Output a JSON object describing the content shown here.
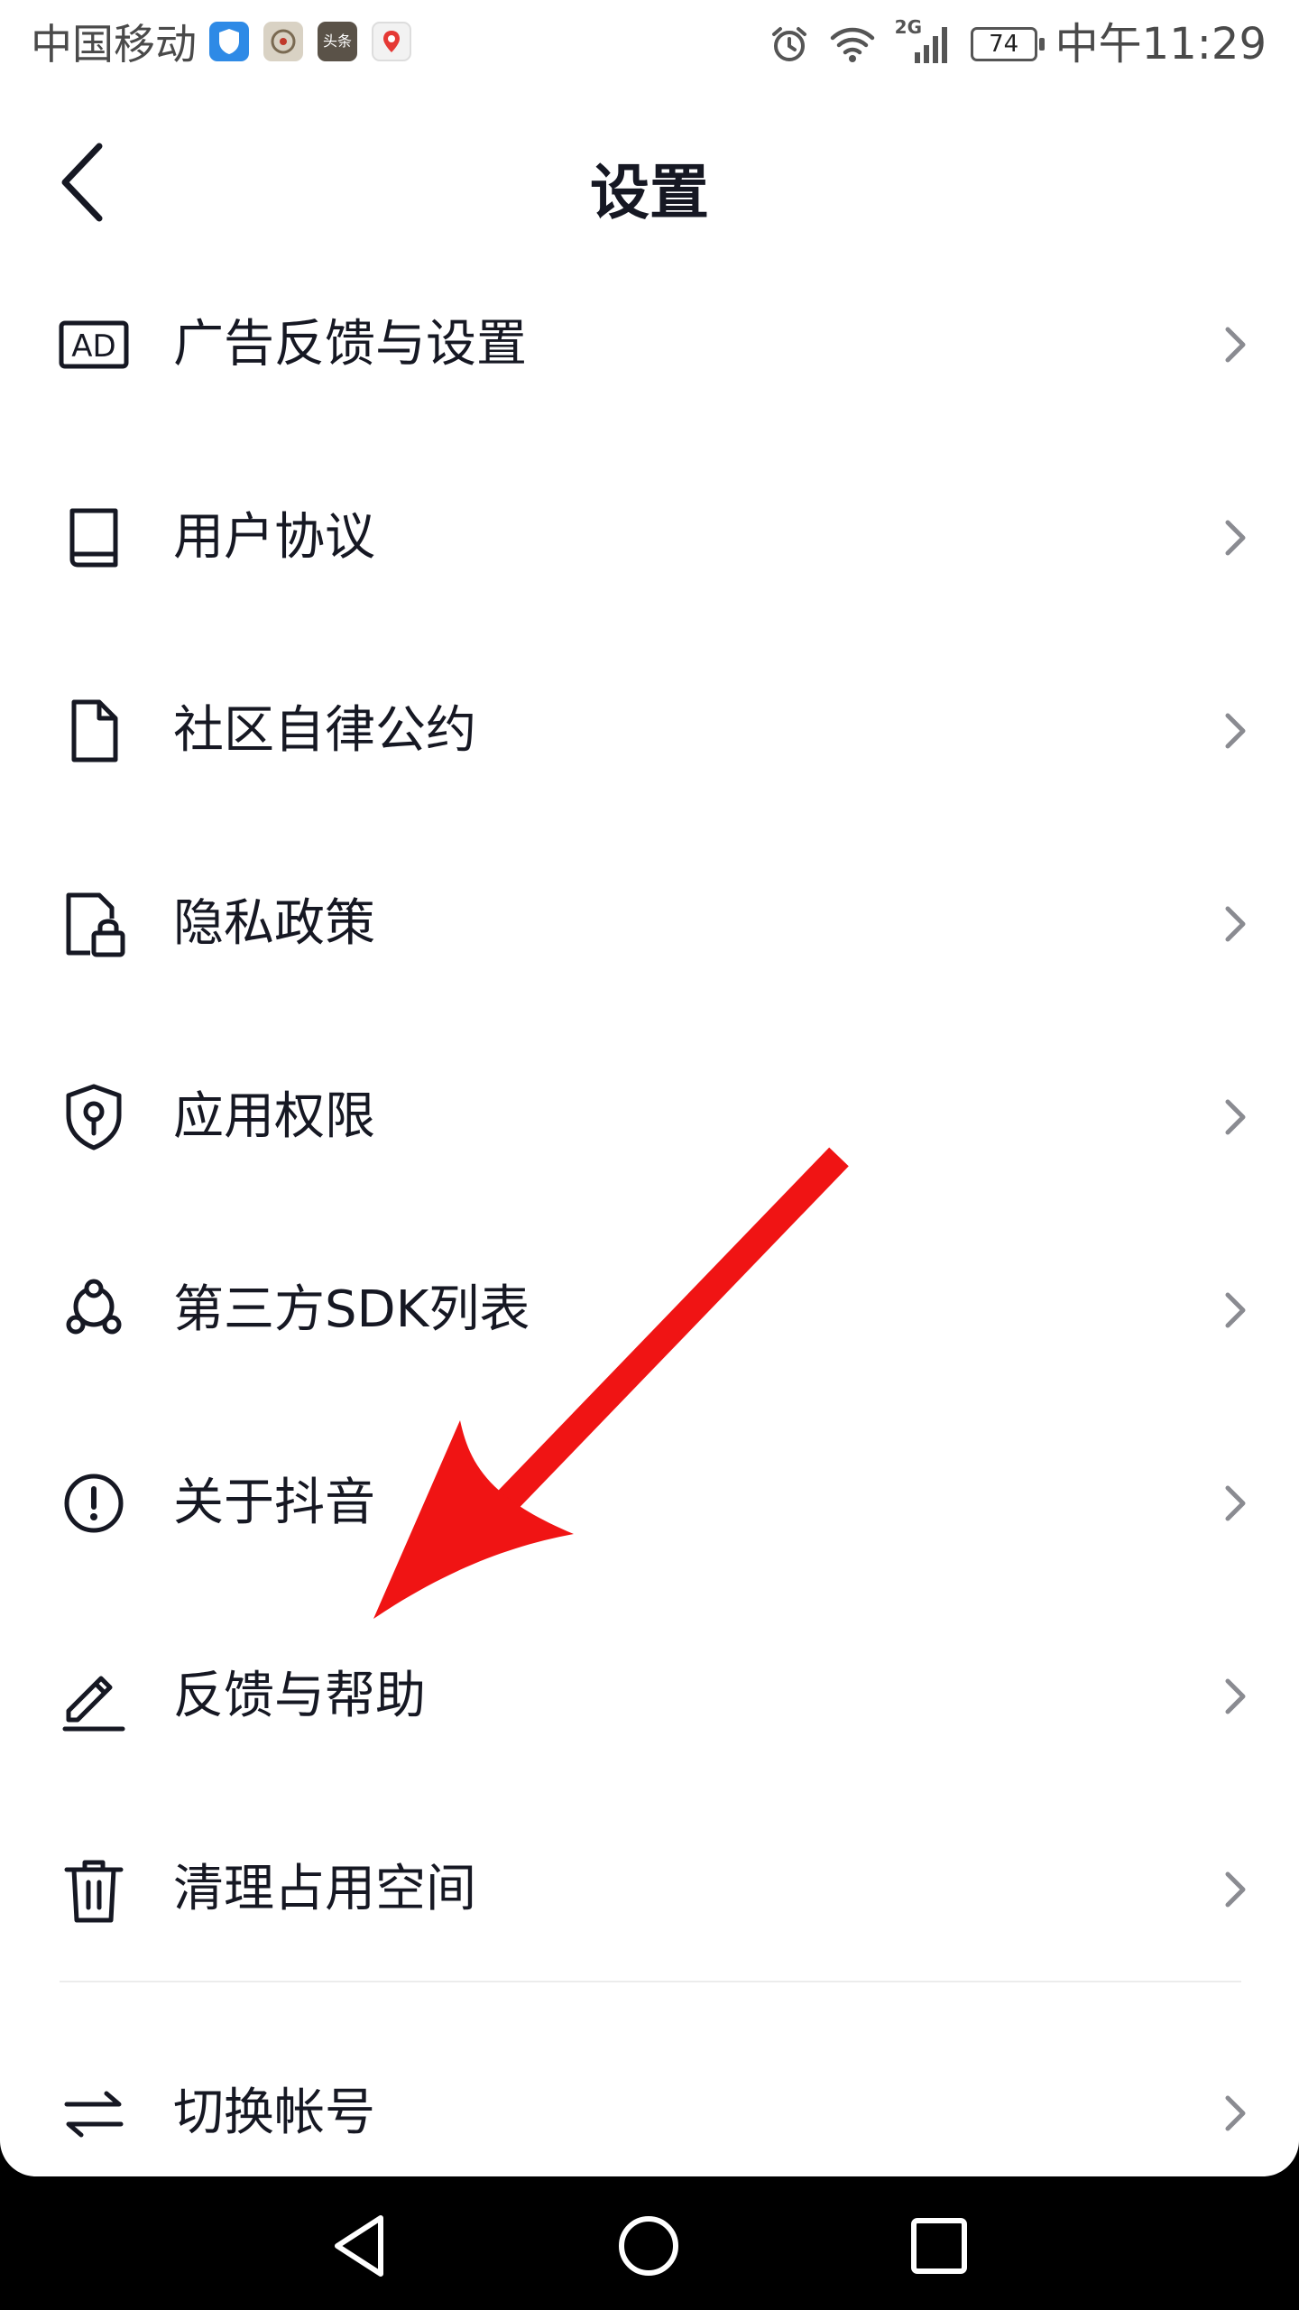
{
  "status_bar": {
    "carrier": "中国移动",
    "notification_icons": [
      "shield-icon",
      "baidu-icon",
      "toutiao-icon",
      "map-icon"
    ],
    "toutiao_text": "头条",
    "network": "2G",
    "battery": "74",
    "time": "中午11:29"
  },
  "header": {
    "title": "设置"
  },
  "menu": {
    "items": [
      {
        "label": "广告反馈与设置",
        "icon": "ad-icon"
      },
      {
        "label": "用户协议",
        "icon": "book-icon"
      },
      {
        "label": "社区自律公约",
        "icon": "document-icon"
      },
      {
        "label": "隐私政策",
        "icon": "privacy-lock-icon"
      },
      {
        "label": "应用权限",
        "icon": "shield-key-icon"
      },
      {
        "label": "第三方SDK列表",
        "icon": "sdk-nodes-icon"
      },
      {
        "label": "关于抖音",
        "icon": "info-alert-icon"
      },
      {
        "label": "反馈与帮助",
        "icon": "pencil-icon"
      },
      {
        "label": "清理占用空间",
        "icon": "trash-icon"
      },
      {
        "label": "切换帐号",
        "icon": "swap-arrows-icon"
      }
    ]
  },
  "ad_icon_text": "AD",
  "colors": {
    "text": "#161823",
    "chevron": "#8a8b91",
    "annotation_arrow": "#f01414",
    "navbar": "#000000"
  },
  "navbar": {
    "buttons": [
      "back-triangle-icon",
      "home-circle-icon",
      "recents-square-icon"
    ]
  }
}
